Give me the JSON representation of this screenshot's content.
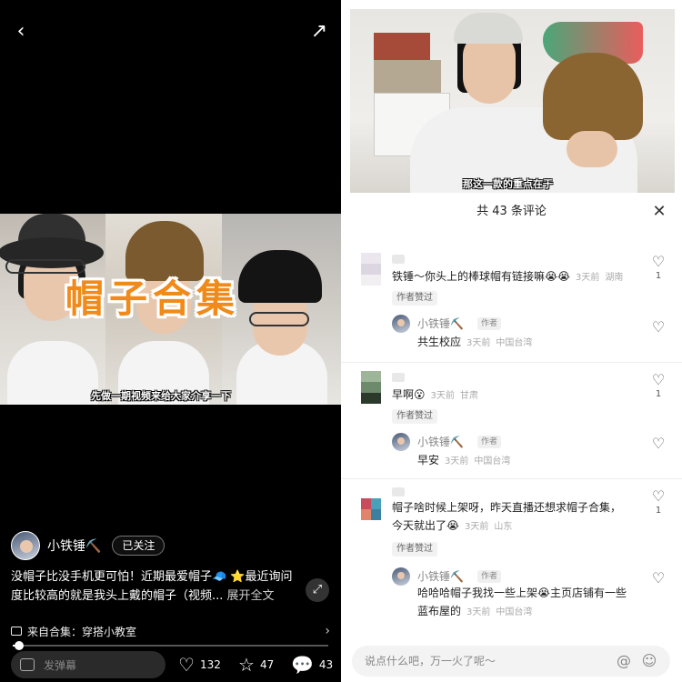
{
  "player": {
    "author_name": "小铁锤⛏️",
    "follow_label": "已关注",
    "video_title_overlay": "帽子合集",
    "video_subtitle": "先做一期视频来给大家介享一下",
    "description": "没帽子比没手机更可怕！近期最爱帽子🧢 ⭐最近询问度比较高的就是我头上戴的帽子（视频...",
    "expand_label": "展开全文",
    "collection_label": "来自合集：穿搭小教室",
    "progress_fraction": 0.02,
    "danmu_placeholder": "发弹幕",
    "likes": "132",
    "favorites": "47",
    "comments": "43"
  },
  "right_video": {
    "caption": "那这一款的重点在于"
  },
  "comments_panel": {
    "title": "共 43 条评论",
    "input_placeholder": "说点什么吧，万一火了呢～",
    "items": [
      {
        "text": "铁锤～你头上的棒球帽有链接嘛😭😭",
        "time": "3天前",
        "location": "湖南",
        "likes": "1",
        "author_liked_tag": "作者赞过",
        "reply": {
          "name": "小铁锤⛏️",
          "role": "作者",
          "text": "共生校应",
          "time": "3天前",
          "location": "中国台湾"
        }
      },
      {
        "text": "早啊😮",
        "time": "3天前",
        "location": "甘肃",
        "likes": "1",
        "author_liked_tag": "作者赞过",
        "reply": {
          "name": "小铁锤⛏️",
          "role": "作者",
          "text": "早安",
          "time": "3天前",
          "location": "中国台湾"
        }
      },
      {
        "text_line1": "帽子啥时候上架呀，昨天直播还想求帽子合集，",
        "text_line2": "今天就出了😭",
        "time": "3天前",
        "location": "山东",
        "likes": "1",
        "author_liked_tag": "作者赞过",
        "reply": {
          "name": "小铁锤⛏️",
          "role": "作者",
          "text_line1": "哈哈哈帽子我找一些上架😭主页店铺有一些",
          "text_line2": "蓝布屋的",
          "time": "3天前",
          "location": "中国台湾"
        }
      }
    ]
  },
  "icons": {
    "back": "chevron-left-icon",
    "share": "share-icon",
    "close": "close-icon",
    "heart": "heart-icon",
    "star": "star-icon",
    "comment": "comment-icon",
    "at": "at-icon",
    "emoji": "emoji-icon"
  },
  "colors": {
    "title_orange": "#f08a1a",
    "background_dark": "#000000",
    "panel_white": "#ffffff"
  }
}
